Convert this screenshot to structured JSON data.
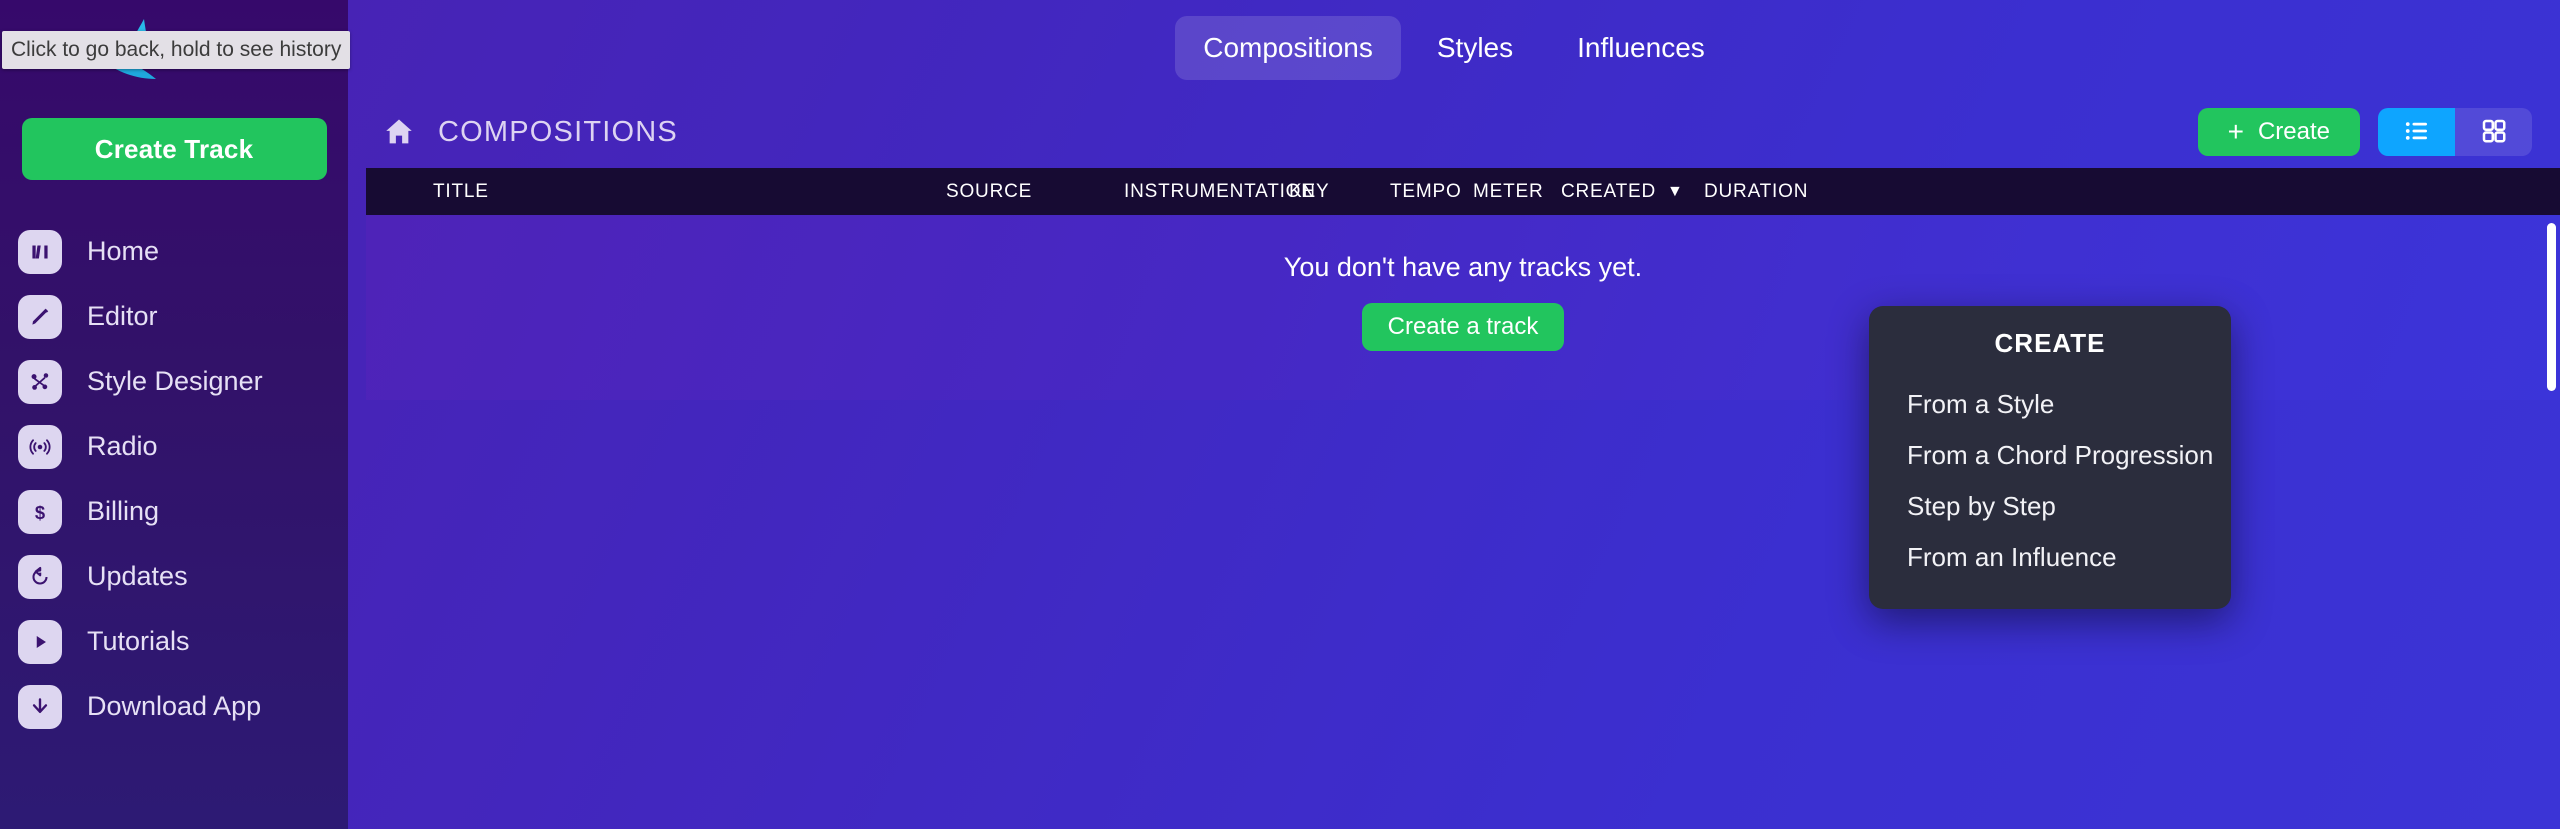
{
  "sidebar": {
    "logo_name": "amper-swirl-logo",
    "tooltip": "Click to go back, hold to see history",
    "create_track_label": "Create Track",
    "items": [
      {
        "label": "Home",
        "icon": "home-bars-icon"
      },
      {
        "label": "Editor",
        "icon": "pencil-icon"
      },
      {
        "label": "Style Designer",
        "icon": "nodes-icon"
      },
      {
        "label": "Radio",
        "icon": "broadcast-icon"
      },
      {
        "label": "Billing",
        "icon": "dollar-icon"
      },
      {
        "label": "Updates",
        "icon": "refresh-icon"
      },
      {
        "label": "Tutorials",
        "icon": "play-icon"
      },
      {
        "label": "Download App",
        "icon": "download-icon"
      }
    ]
  },
  "topnav": {
    "tabs": [
      {
        "label": "Compositions",
        "active": true
      },
      {
        "label": "Styles",
        "active": false
      },
      {
        "label": "Influences",
        "active": false
      }
    ]
  },
  "header": {
    "home_icon": "home-icon",
    "title": "COMPOSITIONS",
    "create_label": "Create",
    "create_plus": "+",
    "view_list_icon": "list-view-icon",
    "view_grid_icon": "grid-view-icon"
  },
  "table": {
    "columns": [
      "TITLE",
      "SOURCE",
      "INSTRUMENTATION",
      "KEY",
      "TEMPO",
      "METER",
      "CREATED",
      "DURATION"
    ],
    "sort_column": "CREATED",
    "sort_caret": "▼",
    "rows": []
  },
  "empty_state": {
    "message": "You don't have any tracks yet.",
    "cta_label": "Create a track"
  },
  "dropdown": {
    "title": "CREATE",
    "items": [
      "From a Style",
      "From a Chord Progression",
      "Step by Step",
      "From an Influence"
    ]
  },
  "colors": {
    "green": "#22c55e",
    "blue_active": "#0ea5ff",
    "sidebar_purple": "#36096b",
    "table_header": "#170b33",
    "dropdown_bg": "#2b2d3d"
  }
}
